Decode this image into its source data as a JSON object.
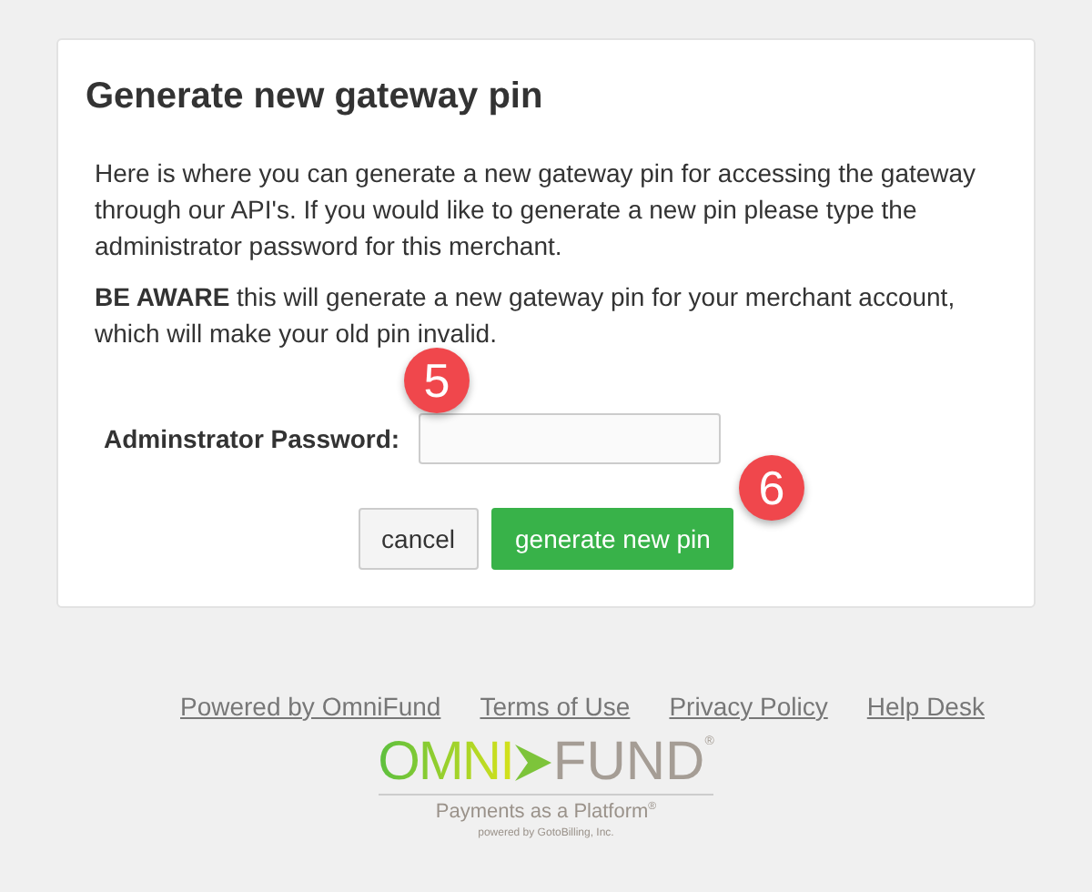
{
  "dialog": {
    "title": "Generate new gateway pin",
    "intro": "Here is where you can generate a new gateway pin for accessing the gateway through our API's. If you would like to generate a new pin please type the administrator password for this merchant.",
    "warning": "**BE AWARE** this will generate a new gateway pin for your merchant account, which will make your old pin invalid.",
    "password_label": "Adminstrator Password:",
    "buttons": [
      {
        "label": "cancel",
        "kind": "default"
      },
      {
        "label": "generate new pin",
        "kind": "primary"
      }
    ]
  },
  "callouts": [
    {
      "number": "5"
    },
    {
      "number": "6"
    }
  ],
  "footer": {
    "links": [
      "Powered by OmniFund",
      "Terms of Use",
      "Privacy Policy",
      "Help Desk"
    ],
    "logo": {
      "left": "OMNI",
      "right": "FUND",
      "mark": "®",
      "tagline": "Payments as a Platform",
      "tagline_mark": "®",
      "credit": "powered by GotoBilling, Inc."
    }
  }
}
